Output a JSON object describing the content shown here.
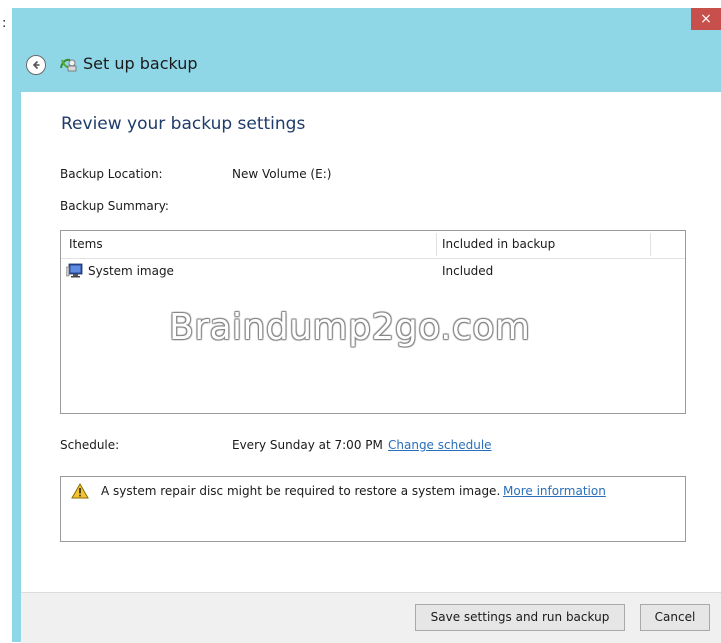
{
  "window": {
    "title": "Set up backup",
    "close_label": "×"
  },
  "stray": ":",
  "page": {
    "heading": "Review your backup settings",
    "backup_location_label": "Backup Location:",
    "backup_location_value": "New Volume (E:)",
    "backup_summary_label": "Backup Summary:"
  },
  "table": {
    "columns": [
      "Items",
      "Included in backup"
    ],
    "rows": [
      {
        "item": "System image",
        "included": "Included"
      }
    ]
  },
  "watermark": "Braindump2go.com",
  "schedule": {
    "label": "Schedule:",
    "value": "Every Sunday at 7:00 PM",
    "change_link": "Change schedule"
  },
  "info": {
    "message": "A system repair disc might be required to restore a system image.",
    "more_link": "More information"
  },
  "footer": {
    "save_label": "Save settings and run backup",
    "cancel_label": "Cancel"
  },
  "colors": {
    "titlebar": "#8fd7e6",
    "close": "#c7504d",
    "link": "#2a6fb9",
    "heading": "#1f3b6a"
  },
  "icons": {
    "back": "back-arrow-icon",
    "app": "backup-icon",
    "row": "system-image-icon",
    "warning": "warning-icon"
  }
}
